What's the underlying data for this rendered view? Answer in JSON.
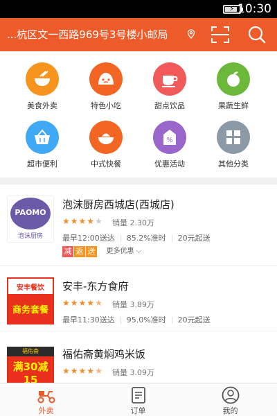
{
  "status_bar": {
    "time": "10:30",
    "battery_level": 0.85
  },
  "header": {
    "address": "...杭区文一西路969号3号楼小邮局",
    "location_icon": "location-pin-icon",
    "scan_icon": "scan-icon",
    "search_icon": "search-icon"
  },
  "categories": [
    {
      "label": "美食外卖",
      "icon": "bowl-icon",
      "color": "#f7941d"
    },
    {
      "label": "特色小吃",
      "icon": "bun-icon",
      "color": "#f26522"
    },
    {
      "label": "甜点饮品",
      "icon": "cup-icon",
      "color": "#f25a5a"
    },
    {
      "label": "果蔬生鲜",
      "icon": "apple-icon",
      "color": "#6cb83a"
    },
    {
      "label": "超市便利",
      "icon": "basket-icon",
      "color": "#3fa9f5"
    },
    {
      "label": "中式快餐",
      "icon": "rice-bowl-icon",
      "color": "#f26522"
    },
    {
      "label": "优惠活动",
      "icon": "discount-tag-icon",
      "color": "#9966cc"
    },
    {
      "label": "其他分类",
      "icon": "grid-icon",
      "color": "#8c9aa8"
    }
  ],
  "stores": [
    {
      "name": "泡沫厨房西城店(西城店)",
      "logo_text": "PAOMO",
      "logo_caption": "泡沫厨房",
      "rating": 4,
      "sales": "销量 2.30万",
      "delivery_time": "最早12:00送达",
      "on_time": "85.2%准时",
      "min_order": "20元起送",
      "promo_badges": [
        {
          "text": "减",
          "color": "#f25a5a"
        },
        {
          "text": "返",
          "color": "#f7941d"
        },
        {
          "text": "送",
          "color": "#f7941d"
        }
      ],
      "more_promos": "更多优惠"
    },
    {
      "name": "安丰-东方食府",
      "logo_text": "安丰餐饮",
      "logo_caption": "商务套餐",
      "rating": 4.5,
      "sales": "销量 3.89万",
      "delivery_time": "最早11:30送达",
      "on_time": "95.0%准时",
      "min_order": "20元起送"
    },
    {
      "name": "福佑斋黄焖鸡米饭",
      "logo_text": "福佑斋",
      "logo_caption": "满30减15",
      "rating": 4.5,
      "sales": "销量 3.09万"
    }
  ],
  "tabs": [
    {
      "label": "外卖",
      "icon": "scooter-icon",
      "active": true
    },
    {
      "label": "订单",
      "icon": "order-list-icon",
      "active": false
    },
    {
      "label": "我的",
      "icon": "profile-icon",
      "active": false
    }
  ],
  "colors": {
    "brand": "#ee5b2b",
    "star": "#f28c2b",
    "inactive": "#555555"
  }
}
